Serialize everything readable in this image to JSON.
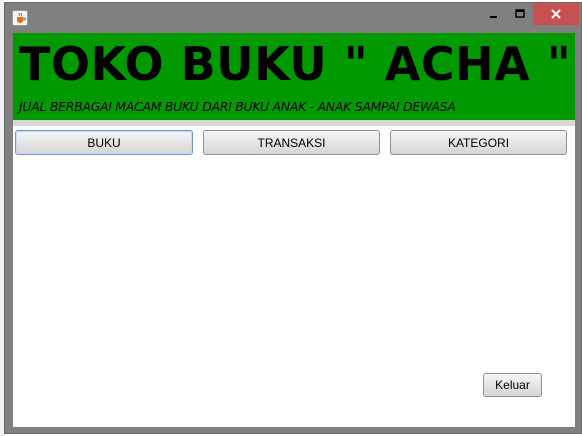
{
  "window": {
    "icon": "java-cup-icon",
    "controls": {
      "minimize": "minimize-icon",
      "maximize": "maximize-icon",
      "close": "close-icon"
    }
  },
  "banner": {
    "title": "TOKO BUKU \" ACHA \"",
    "subtitle": "JUAL BERBAGAI MACAM BUKU DARI BUKU ANAK - ANAK SAMPAI DEWASA",
    "color": "#009900"
  },
  "menu": {
    "buttons": [
      {
        "label": "BUKU",
        "focused": true
      },
      {
        "label": "TRANSAKSI",
        "focused": false
      },
      {
        "label": "KATEGORI",
        "focused": false
      }
    ]
  },
  "footer": {
    "exit_label": "Keluar"
  },
  "colors": {
    "window_frame": "#808080",
    "close_button": "#c75050"
  }
}
